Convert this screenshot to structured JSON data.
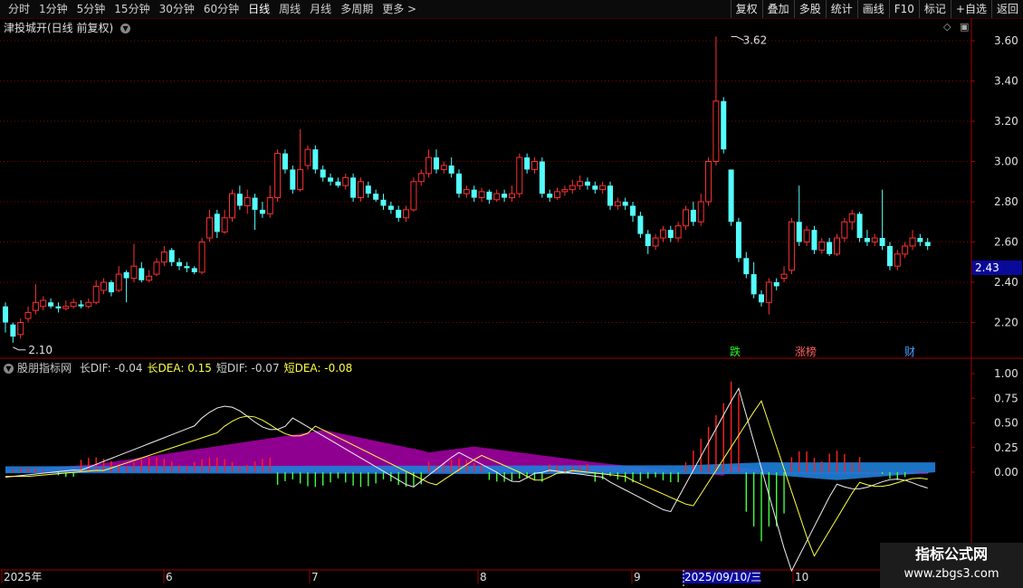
{
  "toolbar": {
    "periods": [
      "分时",
      "1分钟",
      "5分钟",
      "15分钟",
      "30分钟",
      "60分钟",
      "日线",
      "周线",
      "月线",
      "多周期",
      "更多 >"
    ],
    "active_period": "日线",
    "actions": [
      "复权",
      "叠加",
      "多股",
      "统计",
      "画线",
      "F10",
      "标记",
      "+自选",
      "返回"
    ]
  },
  "stock": {
    "title": "津投城开(日线 前复权)"
  },
  "price_axis": {
    "ticks": [
      "3.60",
      "3.40",
      "3.20",
      "3.00",
      "2.80",
      "2.60",
      "2.40",
      "2.20"
    ],
    "current": "2.43"
  },
  "annotations": {
    "high": "3.62",
    "low": "2.10",
    "events": [
      "跌",
      "涨榜",
      "财"
    ]
  },
  "indicator": {
    "name": "股朋指标网",
    "items": [
      {
        "label": "长DIF: -0.04",
        "color": "#d0d0d0"
      },
      {
        "label": "长DEA: 0.15",
        "color": "#ffff40"
      },
      {
        "label": "短DIF: -0.07",
        "color": "#d0d0d0"
      },
      {
        "label": "短DEA: -0.08",
        "color": "#ffff40"
      }
    ],
    "axis_ticks": [
      "1.00",
      "0.75",
      "0.50",
      "0.25",
      "0.00"
    ]
  },
  "time_axis": {
    "labels": [
      "2025年",
      "6",
      "7",
      "8",
      "9",
      "10"
    ],
    "cursor_date": "2025/09/10/三"
  },
  "watermark": {
    "title": "指标公式网",
    "url": "www.zbgs3.com"
  },
  "colors": {
    "up": "#ff3030",
    "down": "#54ffff",
    "grid": "#8a0000",
    "purple": "#a000a0",
    "blue": "#1e7fd8"
  },
  "chart_data": {
    "type": "candlestick",
    "price_range": [
      2.1,
      3.62
    ],
    "candles": [
      [
        2.28,
        2.2,
        2.3,
        2.15
      ],
      [
        2.19,
        2.13,
        2.2,
        2.1
      ],
      [
        2.14,
        2.2,
        2.22,
        2.12
      ],
      [
        2.22,
        2.25,
        2.28,
        2.2
      ],
      [
        2.26,
        2.3,
        2.39,
        2.24
      ],
      [
        2.28,
        2.31,
        2.33,
        2.26
      ],
      [
        2.3,
        2.28,
        2.32,
        2.27
      ],
      [
        2.28,
        2.27,
        2.3,
        2.25
      ],
      [
        2.27,
        2.28,
        2.31,
        2.26
      ],
      [
        2.28,
        2.3,
        2.32,
        2.27
      ],
      [
        2.29,
        2.28,
        2.31,
        2.27
      ],
      [
        2.28,
        2.3,
        2.32,
        2.27
      ],
      [
        2.3,
        2.38,
        2.41,
        2.29
      ],
      [
        2.36,
        2.4,
        2.42,
        2.34
      ],
      [
        2.4,
        2.35,
        2.41,
        2.33
      ],
      [
        2.36,
        2.44,
        2.48,
        2.35
      ],
      [
        2.45,
        2.42,
        2.46,
        2.3
      ],
      [
        2.42,
        2.48,
        2.59,
        2.4
      ],
      [
        2.47,
        2.41,
        2.5,
        2.4
      ],
      [
        2.41,
        2.43,
        2.46,
        2.4
      ],
      [
        2.44,
        2.5,
        2.52,
        2.43
      ],
      [
        2.5,
        2.55,
        2.58,
        2.48
      ],
      [
        2.56,
        2.5,
        2.57,
        2.48
      ],
      [
        2.5,
        2.48,
        2.52,
        2.46
      ],
      [
        2.48,
        2.47,
        2.5,
        2.45
      ],
      [
        2.47,
        2.45,
        2.48,
        2.44
      ],
      [
        2.45,
        2.6,
        2.62,
        2.44
      ],
      [
        2.62,
        2.72,
        2.76,
        2.6
      ],
      [
        2.74,
        2.65,
        2.76,
        2.62
      ],
      [
        2.65,
        2.72,
        2.76,
        2.64
      ],
      [
        2.72,
        2.84,
        2.86,
        2.7
      ],
      [
        2.84,
        2.78,
        2.88,
        2.76
      ],
      [
        2.78,
        2.82,
        2.86,
        2.74
      ],
      [
        2.82,
        2.76,
        2.84,
        2.66
      ],
      [
        2.76,
        2.74,
        2.8,
        2.72
      ],
      [
        2.74,
        2.82,
        2.88,
        2.72
      ],
      [
        2.82,
        3.04,
        3.06,
        2.8
      ],
      [
        3.04,
        2.96,
        3.06,
        2.94
      ],
      [
        2.96,
        2.86,
        2.98,
        2.84
      ],
      [
        2.86,
        2.96,
        3.16,
        2.85
      ],
      [
        2.98,
        3.06,
        3.08,
        2.96
      ],
      [
        3.06,
        2.96,
        3.08,
        2.94
      ],
      [
        2.96,
        2.92,
        2.98,
        2.9
      ],
      [
        2.92,
        2.9,
        2.94,
        2.88
      ],
      [
        2.9,
        2.88,
        2.92,
        2.87
      ],
      [
        2.88,
        2.92,
        2.94,
        2.86
      ],
      [
        2.92,
        2.82,
        2.94,
        2.8
      ],
      [
        2.82,
        2.9,
        2.92,
        2.8
      ],
      [
        2.88,
        2.84,
        2.9,
        2.82
      ],
      [
        2.84,
        2.81,
        2.86,
        2.8
      ],
      [
        2.81,
        2.78,
        2.84,
        2.76
      ],
      [
        2.78,
        2.76,
        2.8,
        2.74
      ],
      [
        2.76,
        2.72,
        2.78,
        2.7
      ],
      [
        2.72,
        2.76,
        2.78,
        2.7
      ],
      [
        2.76,
        2.9,
        2.92,
        2.75
      ],
      [
        2.9,
        2.94,
        2.96,
        2.88
      ],
      [
        2.94,
        3.02,
        3.06,
        2.92
      ],
      [
        3.02,
        2.96,
        3.06,
        2.94
      ],
      [
        2.96,
        2.98,
        3.0,
        2.94
      ],
      [
        2.98,
        2.94,
        3.02,
        2.92
      ],
      [
        2.94,
        2.84,
        2.96,
        2.82
      ],
      [
        2.84,
        2.86,
        2.88,
        2.82
      ],
      [
        2.86,
        2.82,
        2.88,
        2.8
      ],
      [
        2.82,
        2.85,
        2.87,
        2.8
      ],
      [
        2.85,
        2.81,
        2.86,
        2.79
      ],
      [
        2.81,
        2.84,
        2.86,
        2.8
      ],
      [
        2.84,
        2.82,
        2.86,
        2.8
      ],
      [
        2.82,
        2.84,
        2.88,
        2.8
      ],
      [
        2.84,
        3.02,
        3.04,
        2.82
      ],
      [
        3.02,
        2.96,
        3.04,
        2.94
      ],
      [
        2.96,
        3.0,
        3.02,
        2.94
      ],
      [
        3.0,
        2.84,
        3.02,
        2.82
      ],
      [
        2.84,
        2.82,
        2.86,
        2.8
      ],
      [
        2.82,
        2.85,
        2.87,
        2.81
      ],
      [
        2.85,
        2.86,
        2.88,
        2.83
      ],
      [
        2.86,
        2.88,
        2.91,
        2.84
      ],
      [
        2.88,
        2.9,
        2.93,
        2.86
      ],
      [
        2.9,
        2.88,
        2.92,
        2.86
      ],
      [
        2.88,
        2.86,
        2.9,
        2.84
      ],
      [
        2.86,
        2.88,
        2.9,
        2.84
      ],
      [
        2.88,
        2.78,
        2.9,
        2.76
      ],
      [
        2.78,
        2.8,
        2.82,
        2.76
      ],
      [
        2.8,
        2.78,
        2.82,
        2.76
      ],
      [
        2.78,
        2.73,
        2.8,
        2.7
      ],
      [
        2.73,
        2.64,
        2.75,
        2.62
      ],
      [
        2.64,
        2.58,
        2.66,
        2.54
      ],
      [
        2.58,
        2.62,
        2.64,
        2.56
      ],
      [
        2.62,
        2.66,
        2.68,
        2.6
      ],
      [
        2.66,
        2.62,
        2.68,
        2.6
      ],
      [
        2.62,
        2.68,
        2.7,
        2.6
      ],
      [
        2.68,
        2.76,
        2.78,
        2.66
      ],
      [
        2.76,
        2.7,
        2.8,
        2.68
      ],
      [
        2.7,
        2.8,
        2.84,
        2.68
      ],
      [
        2.8,
        3.0,
        3.02,
        2.78
      ],
      [
        3.0,
        3.3,
        3.62,
        2.98
      ],
      [
        3.3,
        3.06,
        3.32,
        3.04
      ],
      [
        2.96,
        2.7,
        2.84,
        2.68
      ],
      [
        2.7,
        2.52,
        2.72,
        2.5
      ],
      [
        2.52,
        2.44,
        2.55,
        2.42
      ],
      [
        2.44,
        2.34,
        2.5,
        2.32
      ],
      [
        2.34,
        2.3,
        2.36,
        2.28
      ],
      [
        2.3,
        2.4,
        2.42,
        2.24
      ],
      [
        2.4,
        2.38,
        2.42,
        2.36
      ],
      [
        2.42,
        2.44,
        2.48,
        2.4
      ],
      [
        2.46,
        2.7,
        2.72,
        2.44
      ],
      [
        2.7,
        2.6,
        2.88,
        2.58
      ],
      [
        2.6,
        2.66,
        2.68,
        2.58
      ],
      [
        2.66,
        2.56,
        2.68,
        2.54
      ],
      [
        2.56,
        2.6,
        2.62,
        2.54
      ],
      [
        2.6,
        2.54,
        2.62,
        2.53
      ],
      [
        2.54,
        2.62,
        2.64,
        2.53
      ],
      [
        2.62,
        2.7,
        2.72,
        2.6
      ],
      [
        2.7,
        2.74,
        2.76,
        2.66
      ],
      [
        2.74,
        2.62,
        2.75,
        2.6
      ],
      [
        2.62,
        2.6,
        2.66,
        2.58
      ],
      [
        2.6,
        2.62,
        2.64,
        2.58
      ],
      [
        2.62,
        2.58,
        2.86,
        2.56
      ],
      [
        2.58,
        2.48,
        2.6,
        2.46
      ],
      [
        2.48,
        2.54,
        2.56,
        2.46
      ],
      [
        2.54,
        2.58,
        2.6,
        2.52
      ],
      [
        2.58,
        2.62,
        2.66,
        2.56
      ],
      [
        2.62,
        2.6,
        2.64,
        2.58
      ],
      [
        2.6,
        2.58,
        2.62,
        2.56
      ]
    ]
  }
}
